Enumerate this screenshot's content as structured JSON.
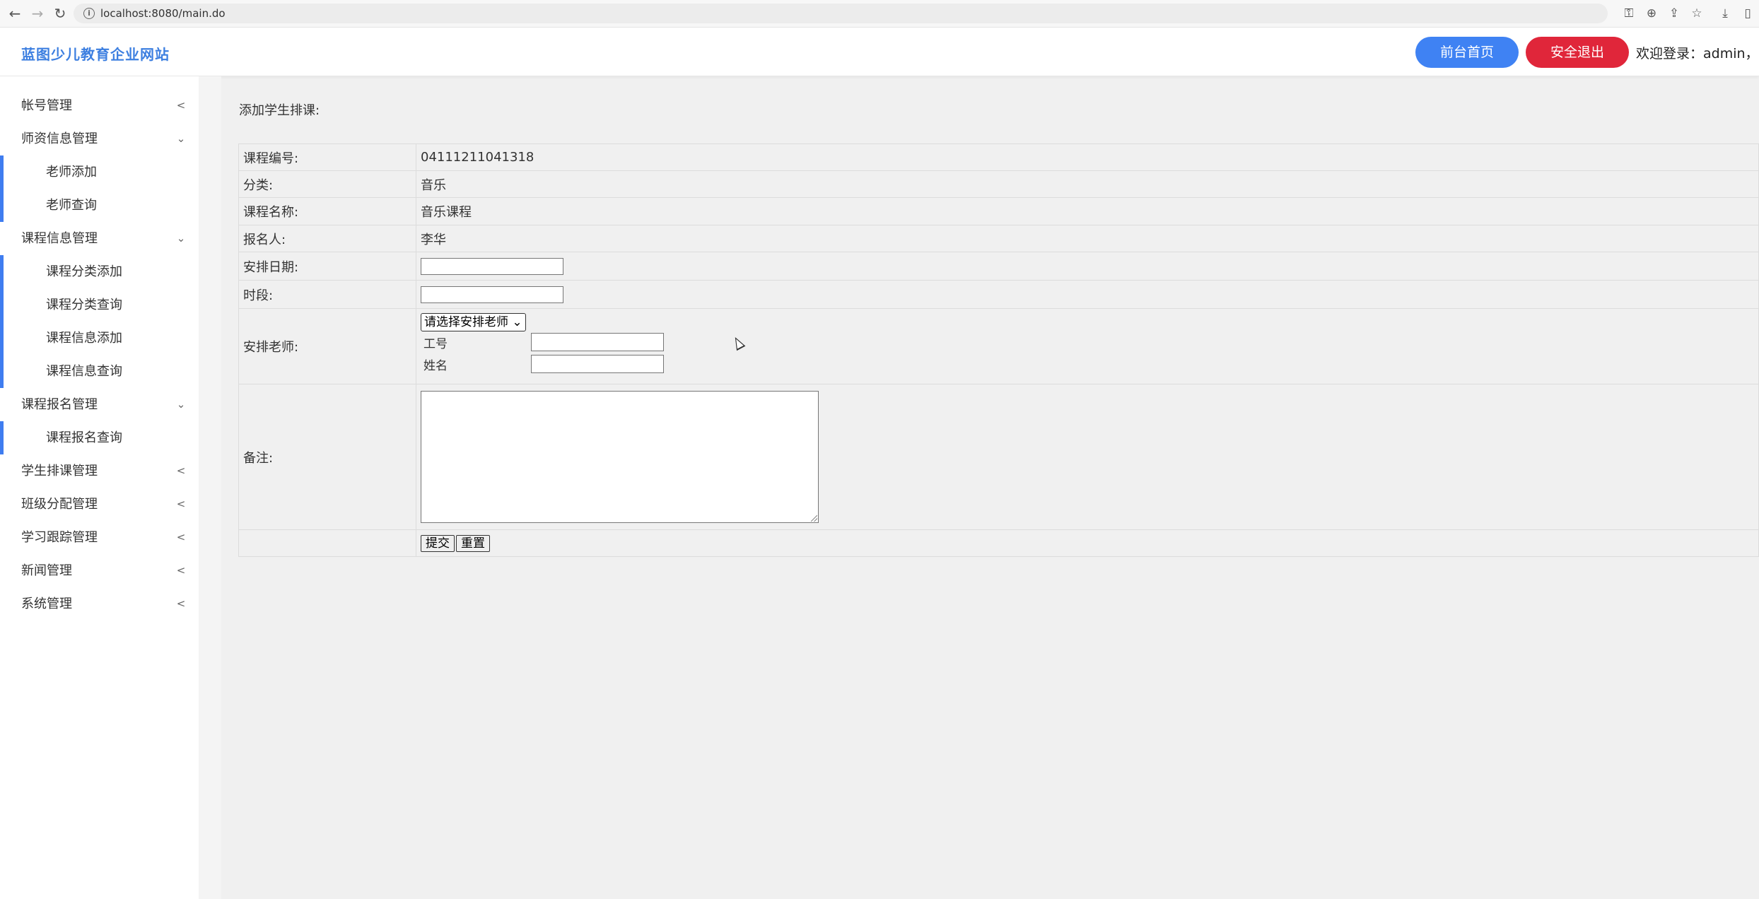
{
  "browser": {
    "url": "localhost:8080/main.do"
  },
  "header": {
    "brand": "蓝图少儿教育企业网站",
    "home_button": "前台首页",
    "logout_button": "安全退出",
    "welcome": "欢迎登录：admin，管"
  },
  "sidebar": {
    "account": "帐号管理",
    "teacher_info": "师资信息管理",
    "teacher_add": "老师添加",
    "teacher_query": "老师查询",
    "course_info": "课程信息管理",
    "course_cat_add": "课程分类添加",
    "course_cat_query": "课程分类查询",
    "course_info_add": "课程信息添加",
    "course_info_query": "课程信息查询",
    "enroll": "课程报名管理",
    "enroll_query": "课程报名查询",
    "schedule": "学生排课管理",
    "class_assign": "班级分配管理",
    "tracking": "学习跟踪管理",
    "news": "新闻管理",
    "system": "系统管理"
  },
  "form": {
    "title": "添加学生排课:",
    "course_no_label": "课程编号:",
    "course_no_value": "04111211041318",
    "category_label": "分类:",
    "category_value": "音乐",
    "course_name_label": "课程名称:",
    "course_name_value": "音乐课程",
    "applicant_label": "报名人:",
    "applicant_value": "李华",
    "date_label": "安排日期:",
    "period_label": "时段:",
    "teacher_label": "安排老师:",
    "teacher_select": "请选择安排老师",
    "job_no_label": "工号",
    "name_label": "姓名",
    "remark_label": "备注:",
    "submit": "提交",
    "reset": "重置"
  }
}
